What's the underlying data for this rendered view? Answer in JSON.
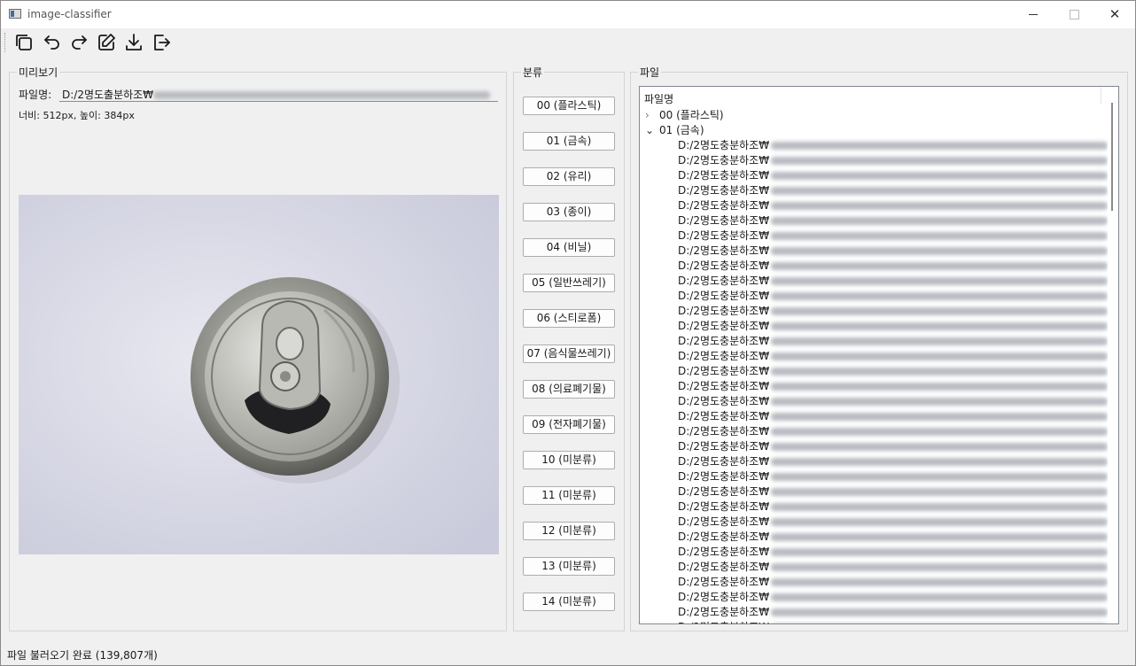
{
  "window": {
    "title": "image-classifier"
  },
  "toolbar": {
    "buttons": [
      {
        "name": "copy-icon"
      },
      {
        "name": "undo-icon"
      },
      {
        "name": "redo-icon"
      },
      {
        "name": "edit-icon"
      },
      {
        "name": "download-icon"
      },
      {
        "name": "exit-icon"
      }
    ]
  },
  "preview": {
    "group_label": "미리보기",
    "filename_label": "파일명:",
    "filename_value": "D:/2명도출분하조₩",
    "dimensions": "너비: 512px, 높이: 384px"
  },
  "classify": {
    "group_label": "분류",
    "buttons": [
      "00 (플라스틱)",
      "01 (금속)",
      "02 (유리)",
      "03 (종이)",
      "04 (비닐)",
      "05 (일반쓰레기)",
      "06 (스티로폼)",
      "07 (음식물쓰레기)",
      "08 (의료폐기물)",
      "09 (전자폐기물)",
      "10 (미분류)",
      "11 (미분류)",
      "12 (미분류)",
      "13 (미분류)",
      "14 (미분류)"
    ]
  },
  "files": {
    "group_label": "파일",
    "header": "파일명",
    "folders": [
      {
        "label": "00 (플라스틱)",
        "expanded": false
      },
      {
        "label": "01 (금속)",
        "expanded": true
      }
    ],
    "file_prefix": "D:/2명도충분하조₩",
    "file_count_visible": 33
  },
  "status": {
    "text": "파일 불러오기 완료 (139,807개)"
  },
  "colors": {
    "background": "#f0f0f0",
    "preview_bg": "#d9dae6",
    "border": "#828790"
  }
}
